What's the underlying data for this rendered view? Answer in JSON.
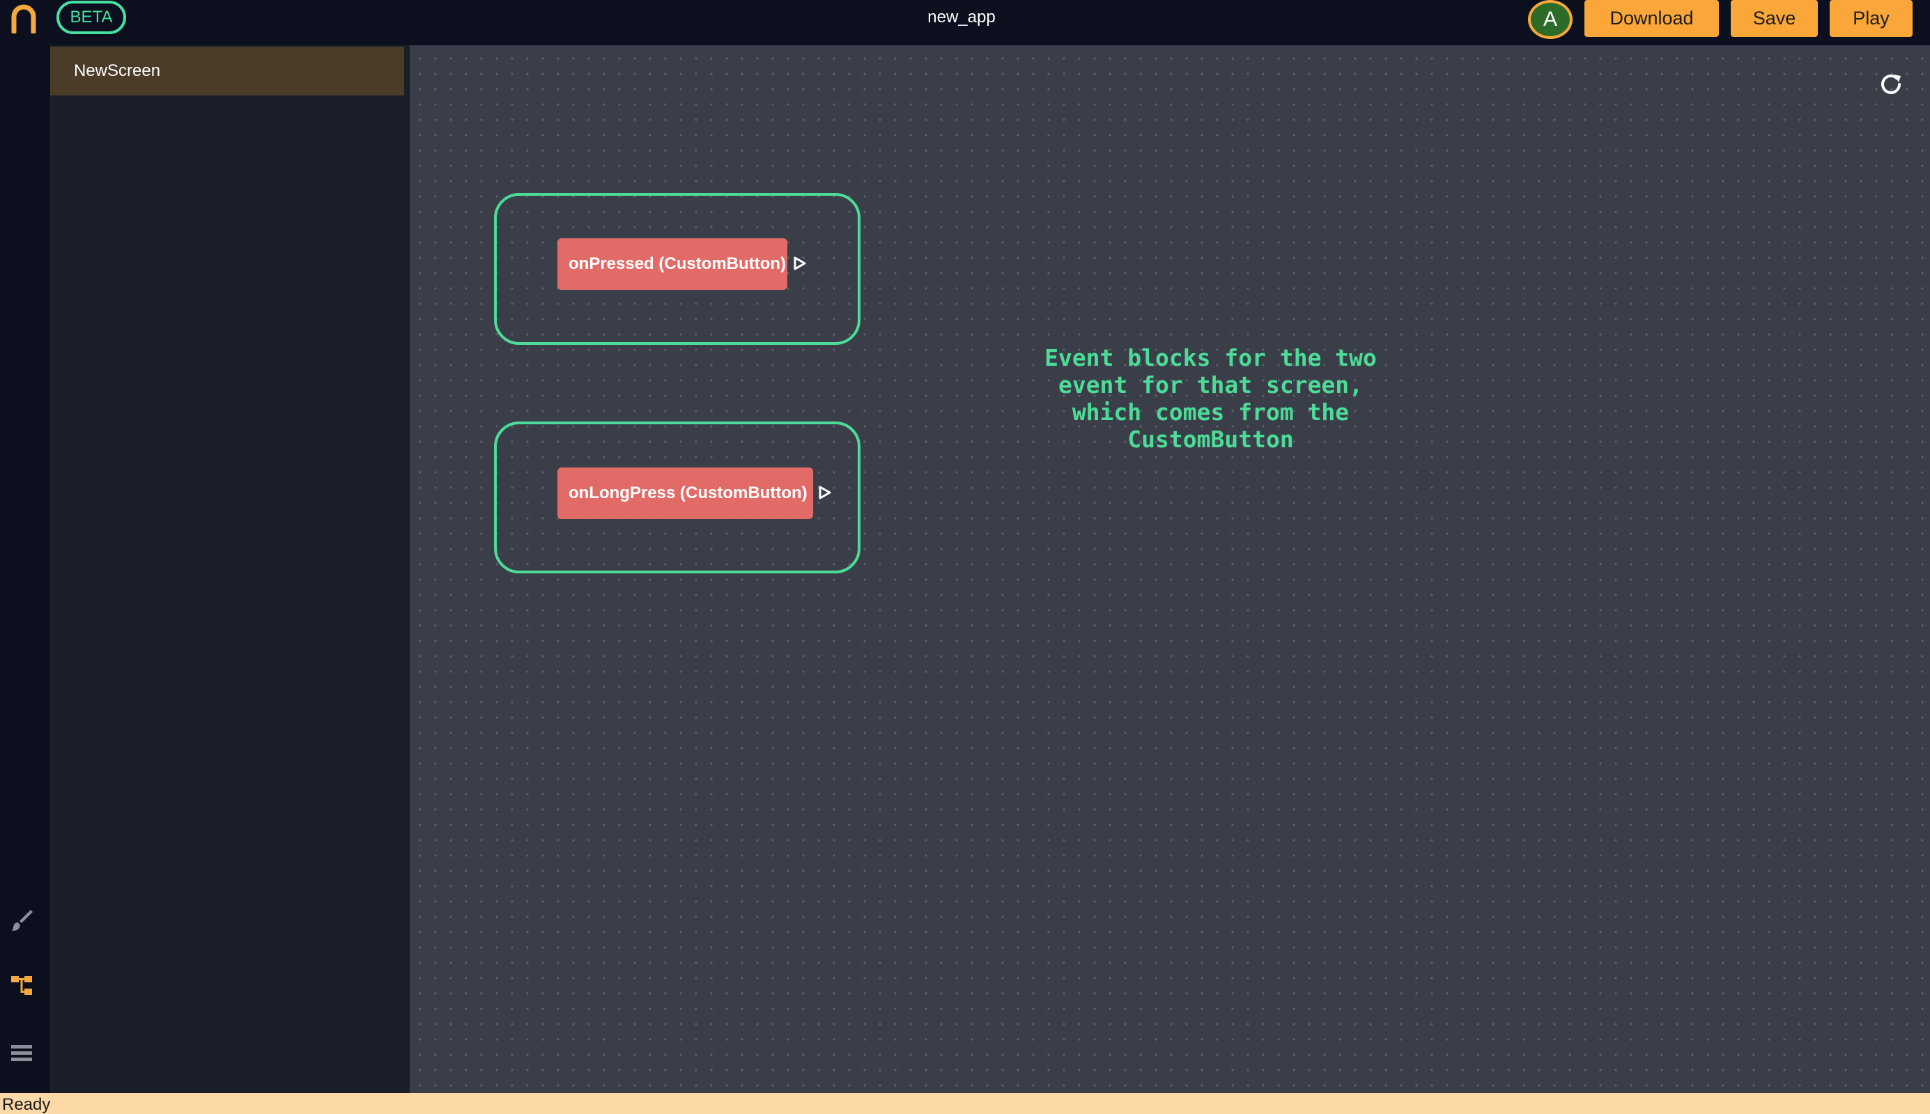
{
  "header": {
    "badge": "BETA",
    "app_title": "new_app",
    "avatar_initial": "A",
    "download_label": "Download",
    "save_label": "Save",
    "play_label": "Play",
    "accent_color": "#fba638",
    "beta_color": "#45e0a2"
  },
  "sidebar": {
    "rail_icons": [
      "brush-icon",
      "block-tree-icon",
      "list-icon"
    ],
    "screens": [
      {
        "label": "NewScreen",
        "selected": true
      }
    ]
  },
  "canvas": {
    "refresh_icon": "refresh-icon",
    "event_blocks": [
      {
        "label": "onPressed (CustomButton)"
      },
      {
        "label": "onLongPress (CustomButton)"
      }
    ],
    "annotation": "Event blocks for the two\nevent for that screen,\nwhich comes from the\nCustomButton",
    "group_border_color": "#4ddc98",
    "event_block_color": "#e26b68"
  },
  "status": {
    "text": "Ready"
  }
}
